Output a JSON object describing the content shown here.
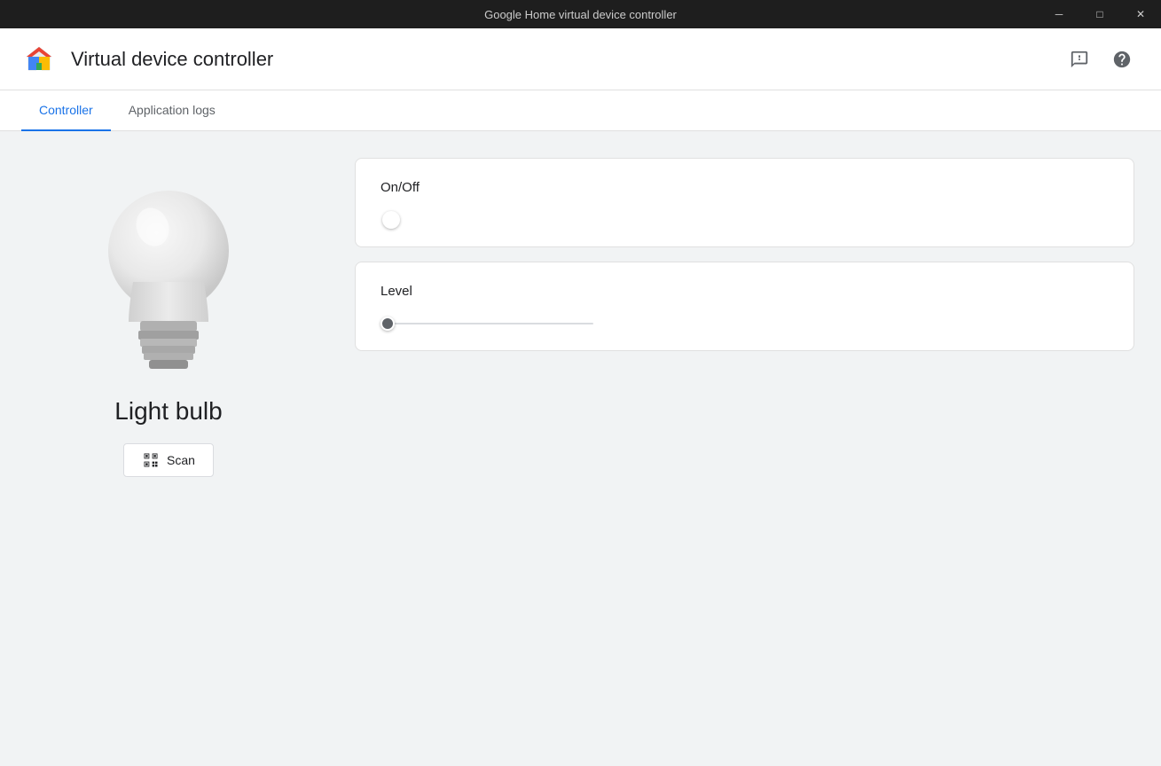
{
  "window": {
    "title": "Google Home virtual device controller",
    "controls": {
      "minimize": "─",
      "maximize": "□",
      "close": "✕"
    }
  },
  "header": {
    "app_title": "Virtual device controller",
    "feedback_icon": "feedback-icon",
    "help_icon": "help-icon"
  },
  "tabs": [
    {
      "id": "controller",
      "label": "Controller",
      "active": true
    },
    {
      "id": "application-logs",
      "label": "Application logs",
      "active": false
    }
  ],
  "left_panel": {
    "device_name": "Light bulb",
    "scan_button_label": "Scan"
  },
  "right_panel": {
    "onoff_card": {
      "title": "On/Off",
      "toggle_state": false
    },
    "level_card": {
      "title": "Level",
      "slider_value": 0,
      "slider_min": 0,
      "slider_max": 100
    }
  }
}
